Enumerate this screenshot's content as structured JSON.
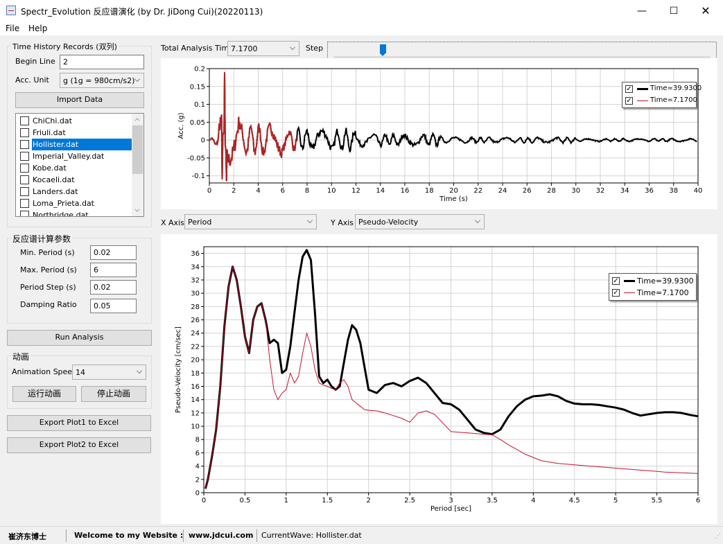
{
  "window": {
    "title": "Spectr_Evolution 反应谱演化 (by Dr. JiDong Cui)(20220113)",
    "minimize": "—",
    "maximize": "☐",
    "close": "✕"
  },
  "menu": [
    "File",
    "Help"
  ],
  "records": {
    "group_title": "Time History Records (双列)",
    "begin_line_label": "Begin Line",
    "begin_line_value": "2",
    "acc_unit_label": "Acc. Unit",
    "acc_unit_value": "g (1g = 980cm/s2)",
    "import_label": "Import Data",
    "files": [
      {
        "name": "ChiChi.dat",
        "checked": false,
        "selected": false
      },
      {
        "name": "Friuli.dat",
        "checked": false,
        "selected": false
      },
      {
        "name": "Hollister.dat",
        "checked": false,
        "selected": true
      },
      {
        "name": "Imperial_Valley.dat",
        "checked": false,
        "selected": false
      },
      {
        "name": "Kobe.dat",
        "checked": false,
        "selected": false
      },
      {
        "name": "Kocaeli.dat",
        "checked": false,
        "selected": false
      },
      {
        "name": "Landers.dat",
        "checked": false,
        "selected": false
      },
      {
        "name": "Loma_Prieta.dat",
        "checked": false,
        "selected": false
      },
      {
        "name": "Northridge.dat",
        "checked": false,
        "selected": false
      }
    ]
  },
  "params": {
    "group_title": "反应谱计算参数",
    "min_period_label": "Min. Period (s)",
    "min_period_value": "0.02",
    "max_period_label": "Max. Period (s)",
    "max_period_value": "6",
    "period_step_label": "Period Step  (s)",
    "period_step_value": "0.02",
    "damping_label": "Damping Ratio",
    "damping_value": "0.05"
  },
  "run_label": "Run Analysis",
  "animation": {
    "group_title": "动画",
    "speed_label": "Animation Speed",
    "speed_value": "14",
    "run_anim_label": "运行动画",
    "stop_anim_label": "停止动画"
  },
  "export1_label": "Export Plot1 to Excel",
  "export2_label": "Export Plot2 to Excel",
  "top_controls": {
    "total_time_label": "Total Analysis Time",
    "total_time_value": "7.1700",
    "step_label": "Step",
    "step_fraction": 0.13
  },
  "axis_select": {
    "x_label": "X Axis",
    "x_value": "Period",
    "y_label": "Y Axis",
    "y_value": "Pseudo-Velocity"
  },
  "statusbar": {
    "author": "崔济东博士",
    "welcome": "Welcome to my Website :",
    "website": "www.jdcui.com",
    "current_wave": "CurrentWave: Hollister.dat"
  },
  "colors": {
    "series_full": "#000000",
    "series_current": "#c8102e",
    "accel_full": "#000000",
    "accel_current": "#b22222",
    "grid": "#d3d3d3"
  },
  "chart_data": [
    {
      "type": "line",
      "xlabel": "Time (s)",
      "ylabel": "Acc. (g)",
      "xlim": [
        0,
        40
      ],
      "ylim": [
        -0.12,
        0.2
      ],
      "xticks": [
        0,
        2,
        4,
        6,
        8,
        10,
        12,
        14,
        16,
        18,
        20,
        22,
        24,
        26,
        28,
        30,
        32,
        34,
        36,
        38,
        40
      ],
      "yticks": [
        -0.1,
        -0.05,
        0,
        0.05,
        0.1,
        0.15,
        0.2
      ],
      "ytick_labels": [
        "-0.1",
        "-0.05",
        "0",
        "0.05",
        "0.1",
        "0.15",
        "0.2"
      ],
      "legend_position": "top-right",
      "series": [
        {
          "name": "Time=39.9300",
          "t_end": 39.93,
          "key": "full"
        },
        {
          "name": "Time=7.1700",
          "t_end": 7.17,
          "key": "current"
        }
      ]
    },
    {
      "type": "line",
      "xlabel": "Period [sec]",
      "ylabel": "Pseudo-Velocity [cm/sec]",
      "xlim": [
        0,
        6
      ],
      "ylim": [
        0,
        37
      ],
      "xticks": [
        0,
        0.5,
        1,
        1.5,
        2,
        2.5,
        3,
        3.5,
        4,
        4.5,
        5,
        5.5,
        6
      ],
      "xtick_labels": [
        "0",
        "0.5",
        "1",
        "1.5",
        "2",
        "2.5",
        "3",
        "3.5",
        "4",
        "4.5",
        "5",
        "5.5",
        "6"
      ],
      "yticks": [
        0,
        2,
        4,
        6,
        8,
        10,
        12,
        14,
        16,
        18,
        20,
        22,
        24,
        26,
        28,
        30,
        32,
        34,
        36
      ],
      "legend_position": "top-right",
      "series": [
        {
          "name": "Time=39.9300",
          "x": [
            0.02,
            0.05,
            0.1,
            0.15,
            0.2,
            0.25,
            0.3,
            0.35,
            0.4,
            0.45,
            0.5,
            0.55,
            0.6,
            0.65,
            0.7,
            0.75,
            0.8,
            0.85,
            0.9,
            0.95,
            1.0,
            1.05,
            1.1,
            1.15,
            1.2,
            1.25,
            1.3,
            1.35,
            1.4,
            1.45,
            1.5,
            1.55,
            1.6,
            1.65,
            1.7,
            1.75,
            1.8,
            1.85,
            1.9,
            1.95,
            2.0,
            2.1,
            2.2,
            2.3,
            2.4,
            2.5,
            2.6,
            2.7,
            2.8,
            2.9,
            3.0,
            3.1,
            3.2,
            3.3,
            3.4,
            3.5,
            3.6,
            3.7,
            3.8,
            3.9,
            4.0,
            4.1,
            4.2,
            4.3,
            4.4,
            4.5,
            4.6,
            4.7,
            4.8,
            4.9,
            5.0,
            5.1,
            5.2,
            5.3,
            5.4,
            5.5,
            5.6,
            5.7,
            5.8,
            5.9,
            6.0
          ],
          "y": [
            0.6,
            2.0,
            5.5,
            9.5,
            16.0,
            25.0,
            31.0,
            34.0,
            32.0,
            28.0,
            23.5,
            21.0,
            26.0,
            28.0,
            28.5,
            26.0,
            22.5,
            23.0,
            22.5,
            18.0,
            18.5,
            22.0,
            27.0,
            32.0,
            35.5,
            36.5,
            35.0,
            27.0,
            17.5,
            16.5,
            17.0,
            16.0,
            15.5,
            16.0,
            19.5,
            23.0,
            25.2,
            24.5,
            22.5,
            19.0,
            15.5,
            15.0,
            16.2,
            16.5,
            16.0,
            16.8,
            17.3,
            16.5,
            15.0,
            13.5,
            13.3,
            12.5,
            11.0,
            9.5,
            9.0,
            8.8,
            9.5,
            11.5,
            13.0,
            14.0,
            14.5,
            14.6,
            14.8,
            14.5,
            13.8,
            13.4,
            13.3,
            13.3,
            13.2,
            13.0,
            12.8,
            12.5,
            12.0,
            11.6,
            11.8,
            12.0,
            12.1,
            12.1,
            12.0,
            11.7,
            11.5
          ]
        },
        {
          "name": "Time=7.1700",
          "x": [
            0.02,
            0.05,
            0.1,
            0.15,
            0.2,
            0.25,
            0.3,
            0.35,
            0.4,
            0.45,
            0.5,
            0.55,
            0.6,
            0.65,
            0.7,
            0.75,
            0.8,
            0.85,
            0.9,
            0.95,
            1.0,
            1.05,
            1.1,
            1.15,
            1.2,
            1.25,
            1.3,
            1.35,
            1.4,
            1.45,
            1.5,
            1.55,
            1.6,
            1.65,
            1.7,
            1.75,
            1.8,
            1.85,
            1.9,
            1.95,
            2.0,
            2.1,
            2.2,
            2.3,
            2.4,
            2.5,
            2.6,
            2.7,
            2.8,
            2.9,
            3.0,
            3.1,
            3.2,
            3.3,
            3.4,
            3.5,
            3.6,
            3.7,
            3.8,
            3.9,
            4.0,
            4.1,
            4.2,
            4.3,
            4.4,
            4.5,
            4.6,
            4.7,
            4.8,
            4.9,
            5.0,
            5.1,
            5.2,
            5.3,
            5.4,
            5.5,
            5.6,
            5.7,
            5.8,
            5.9,
            6.0
          ],
          "y": [
            0.6,
            2.0,
            5.5,
            9.5,
            16.0,
            25.0,
            31.0,
            34.0,
            32.0,
            28.0,
            23.5,
            21.0,
            26.0,
            28.0,
            28.5,
            26.0,
            20.0,
            15.5,
            14.0,
            15.0,
            15.5,
            18.0,
            16.5,
            17.5,
            21.0,
            24.0,
            22.0,
            18.5,
            16.5,
            16.2,
            16.0,
            15.7,
            15.5,
            16.5,
            17.0,
            16.0,
            14.0,
            13.5,
            13.0,
            12.5,
            12.4,
            12.3,
            12.0,
            11.6,
            11.2,
            10.6,
            12.0,
            12.3,
            11.8,
            10.5,
            9.2,
            9.1,
            9.0,
            8.9,
            8.8,
            8.7,
            8.0,
            7.2,
            6.5,
            5.8,
            5.3,
            4.8,
            4.6,
            4.4,
            4.3,
            4.2,
            4.1,
            4.0,
            3.9,
            3.8,
            3.7,
            3.6,
            3.5,
            3.4,
            3.3,
            3.2,
            3.1,
            3.05,
            3.0,
            2.95,
            2.9
          ]
        }
      ]
    }
  ]
}
